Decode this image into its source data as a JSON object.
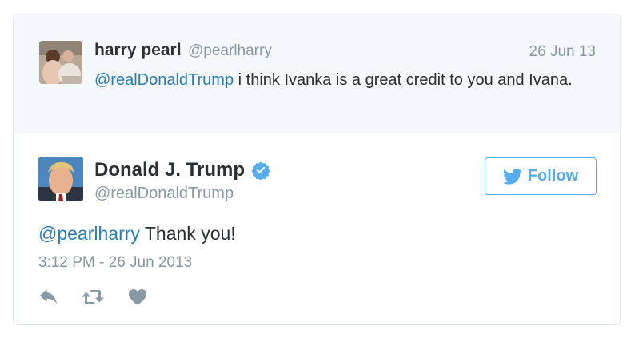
{
  "parent_tweet": {
    "author_name": "harry pearl",
    "author_handle": "@pearlharry",
    "date": "26 Jun 13",
    "mention": "@realDonaldTrump",
    "text": " i think Ivanka is a great credit to you and Ivana."
  },
  "main_tweet": {
    "author_name": "Donald J. Trump",
    "author_handle": "@realDonaldTrump",
    "verified": true,
    "follow_label": "Follow",
    "mention": "@pearlharry",
    "text": " Thank you!",
    "timestamp": "3:12 PM - 26 Jun 2013"
  },
  "actions": [
    "reply-icon",
    "retweet-icon",
    "like-icon"
  ],
  "colors": {
    "link": "#2b7bb9",
    "twitter_blue": "#55acee",
    "muted": "#8899a6",
    "text": "#292f33",
    "parent_bg": "#f5f8fa",
    "border": "#e1e8ed"
  }
}
